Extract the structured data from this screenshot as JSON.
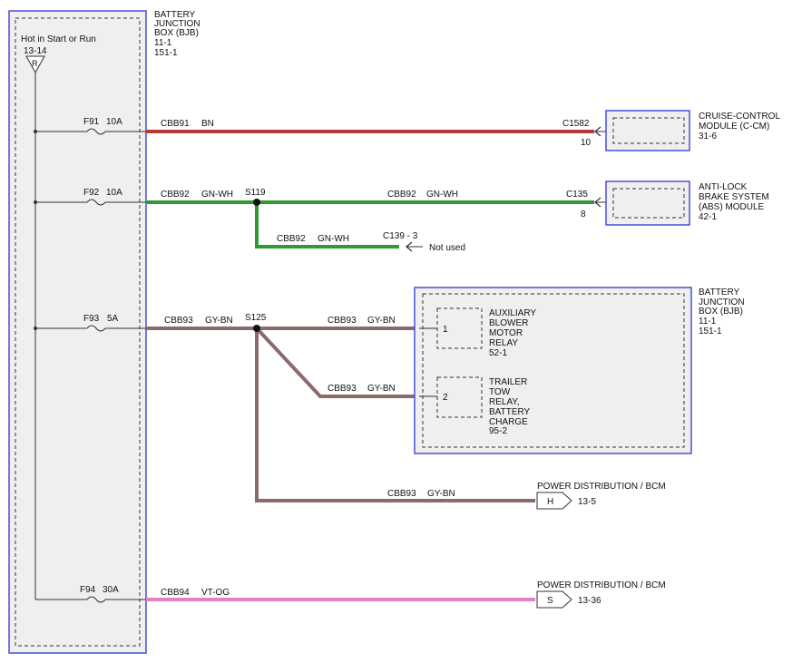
{
  "colors": {
    "box_fill": "#efefef",
    "box_border": "#4a4fd4",
    "wire_bn": "#b43a3a",
    "wire_gn_wh": "#2f9a2f",
    "wire_gy_bn": "#8a6a6a",
    "wire_vt_og": "#e27fc9",
    "line": "#333333"
  },
  "bjb_left": {
    "title": [
      "BATTERY",
      "JUNCTION",
      "BOX (BJB)",
      "11-1",
      "151-1"
    ],
    "hot_label": "Hot in Start or Run",
    "hot_ref": "13-14",
    "hot_letter": "R"
  },
  "fuses": [
    {
      "id": "F91",
      "rating": "10A"
    },
    {
      "id": "F92",
      "rating": "10A"
    },
    {
      "id": "F93",
      "rating": "5A"
    },
    {
      "id": "F94",
      "rating": "30A"
    }
  ],
  "wires": {
    "cbb91": {
      "circuit": "CBB91",
      "color": "BN"
    },
    "cbb92_a": {
      "circuit": "CBB92",
      "color": "GN-WH"
    },
    "cbb92_b": {
      "circuit": "CBB92",
      "color": "GN-WH"
    },
    "cbb92_c": {
      "circuit": "CBB92",
      "color": "GN-WH"
    },
    "cbb93_a": {
      "circuit": "CBB93",
      "color": "GY-BN"
    },
    "cbb93_b": {
      "circuit": "CBB93",
      "color": "GY-BN"
    },
    "cbb93_c": {
      "circuit": "CBB93",
      "color": "GY-BN"
    },
    "cbb93_d": {
      "circuit": "CBB93",
      "color": "GY-BN"
    },
    "cbb94": {
      "circuit": "CBB94",
      "color": "VT-OG"
    }
  },
  "splices": {
    "s119": "S119",
    "s125": "S125"
  },
  "connectors": {
    "c1582": {
      "name": "C1582",
      "pin": "10"
    },
    "c135": {
      "name": "C135",
      "pin": "8"
    },
    "c139": {
      "name": "C139 - 3",
      "note": "Not used"
    }
  },
  "modules": {
    "ccm": {
      "lines": [
        "CRUISE-CONTROL",
        "MODULE (C-CM)",
        "31-6"
      ]
    },
    "abs": {
      "lines": [
        "ANTI-LOCK",
        "BRAKE SYSTEM",
        "(ABS) MODULE",
        "42-1"
      ]
    },
    "bjb_right": {
      "lines": [
        "BATTERY",
        "JUNCTION",
        "BOX (BJB)",
        "11-1",
        "151-1"
      ]
    }
  },
  "relays": {
    "aux": {
      "pin": "1",
      "lines": [
        "AUXILIARY",
        "BLOWER",
        "MOTOR",
        "RELAY",
        "52-1"
      ]
    },
    "trailer": {
      "pin": "2",
      "lines": [
        "TRAILER",
        "TOW",
        "RELAY,",
        "BATTERY",
        "CHARGE",
        "95-2"
      ]
    }
  },
  "power_dist": {
    "h": {
      "title": "POWER DISTRIBUTION / BCM",
      "letter": "H",
      "ref": "13-5"
    },
    "s": {
      "title": "POWER DISTRIBUTION / BCM",
      "letter": "S",
      "ref": "13-36"
    }
  }
}
